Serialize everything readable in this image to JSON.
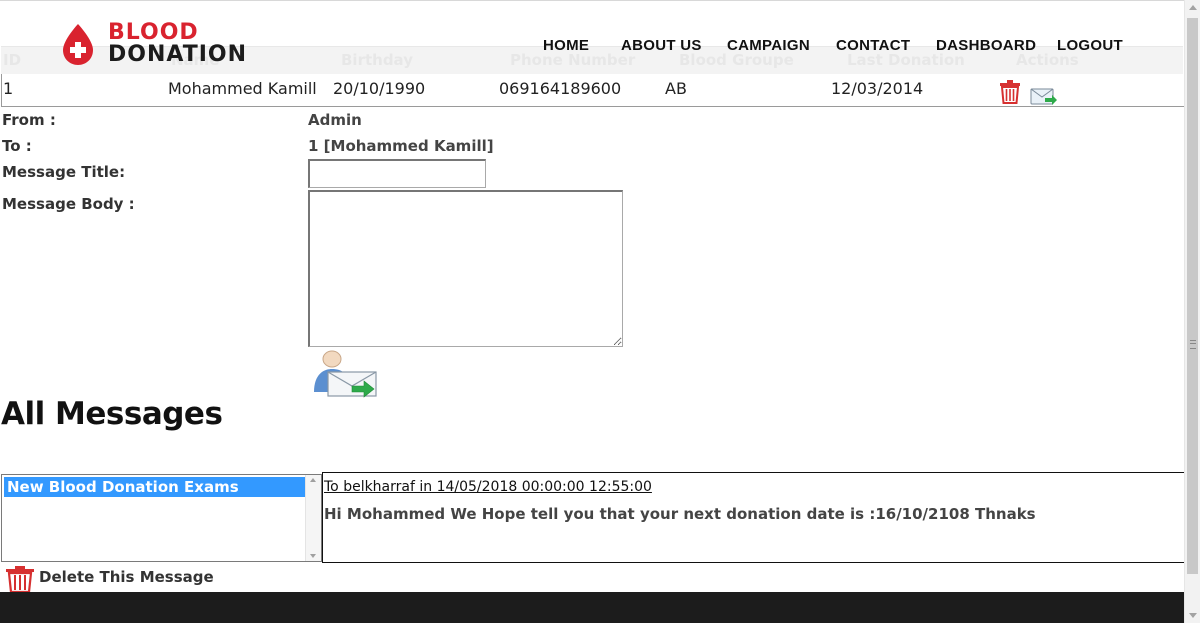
{
  "brand": {
    "line1": "BLOOD",
    "line2": "DONATION",
    "accent_color": "#d9232f"
  },
  "nav": {
    "home": "HOME",
    "about": "ABOUT US",
    "campaign": "CAMPAIGN",
    "contact": "CONTACT",
    "dashboard": "DASHBOARD",
    "logout": "LOGOUT"
  },
  "table": {
    "headers": [
      "ID",
      "Name",
      "Birthday",
      "Phone Number",
      "Blood Groupe",
      "Last Donation",
      "Actions"
    ],
    "row": {
      "id": "1",
      "name": "Mohammed Kamill",
      "birthday": "20/10/1990",
      "phone": "069164189600",
      "blood_group": "AB",
      "last_donation": "12/03/2014"
    }
  },
  "form": {
    "from_label": "From :",
    "from_value": "Admin",
    "to_label": "To :",
    "to_value": "1 [Mohammed Kamill]",
    "title_label": "Message Title:",
    "title_value": "",
    "body_label": "Message Body :",
    "body_value": ""
  },
  "messages": {
    "heading": "All Messages",
    "list": [
      "New Blood Donation Exams"
    ],
    "selected_meta": "To belkharraf in 14/05/2018 00:00:00 12:55:00",
    "selected_body": "Hi Mohammed We Hope tell you that your next donation date is :16/10/2108 Thnaks",
    "selection_color": "#3399ff",
    "delete_label": "Delete This Message"
  },
  "icons": {
    "logo": "blood-drop-cross-icon",
    "trash": "trash-icon",
    "send": "send-message-icon"
  }
}
